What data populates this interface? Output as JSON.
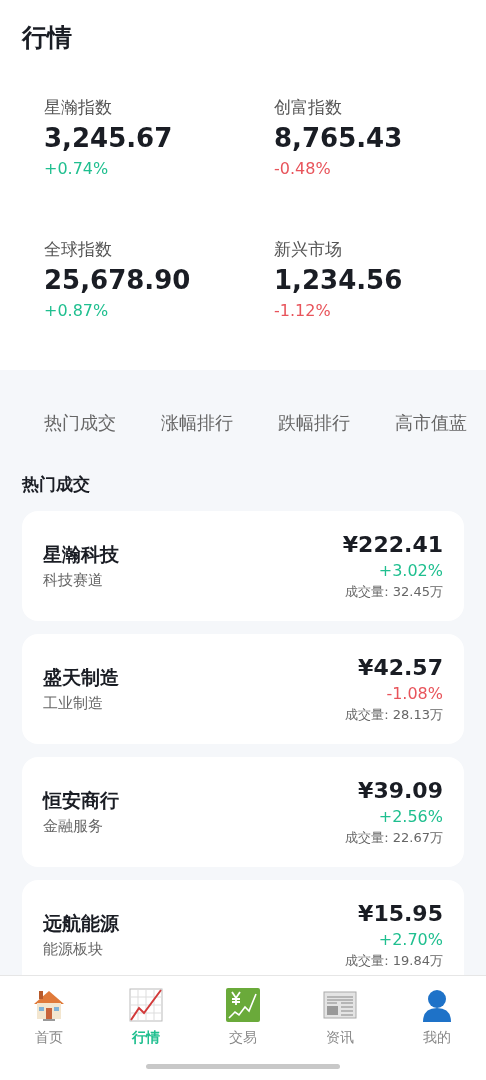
{
  "header": {
    "title": "行情"
  },
  "indices": [
    {
      "name": "星瀚指数",
      "value": "3,245.67",
      "change": "+0.74%",
      "color": "#1fbf8f"
    },
    {
      "name": "创富指数",
      "value": "8,765.43",
      "change": "-0.48%",
      "color": "#e8545b"
    },
    {
      "name": "全球指数",
      "value": "25,678.90",
      "change": "+0.87%",
      "color": "#1fbf8f"
    },
    {
      "name": "新兴市场",
      "value": "1,234.56",
      "change": "-1.12%",
      "color": "#e8545b"
    }
  ],
  "tabs": [
    {
      "label": "热门成交",
      "selected": false
    },
    {
      "label": "涨幅排行",
      "selected": false
    },
    {
      "label": "跌幅排行",
      "selected": false
    },
    {
      "label": "高市值蓝",
      "selected": false
    }
  ],
  "section_title": "热门成交",
  "stocks": [
    {
      "name": "星瀚科技",
      "sector": "科技赛道",
      "price": "¥222.41",
      "change": "+3.02%",
      "color": "#1fbf8f",
      "volume": "成交量: 32.45万"
    },
    {
      "name": "盛天制造",
      "sector": "工业制造",
      "price": "¥42.57",
      "change": "-1.08%",
      "color": "#e8545b",
      "volume": "成交量: 28.13万"
    },
    {
      "name": "恒安商行",
      "sector": "金融服务",
      "price": "¥39.09",
      "change": "+2.56%",
      "color": "#1fbf8f",
      "volume": "成交量: 22.67万"
    },
    {
      "name": "远航能源",
      "sector": "能源板块",
      "price": "¥15.95",
      "change": "+2.70%",
      "color": "#1fbf8f",
      "volume": "成交量: 19.84万"
    }
  ],
  "bottom_nav": [
    {
      "label": "首页",
      "selected": false
    },
    {
      "label": "行情",
      "selected": true
    },
    {
      "label": "交易",
      "selected": false
    },
    {
      "label": "资讯",
      "selected": false
    },
    {
      "label": "我的",
      "selected": false
    }
  ]
}
